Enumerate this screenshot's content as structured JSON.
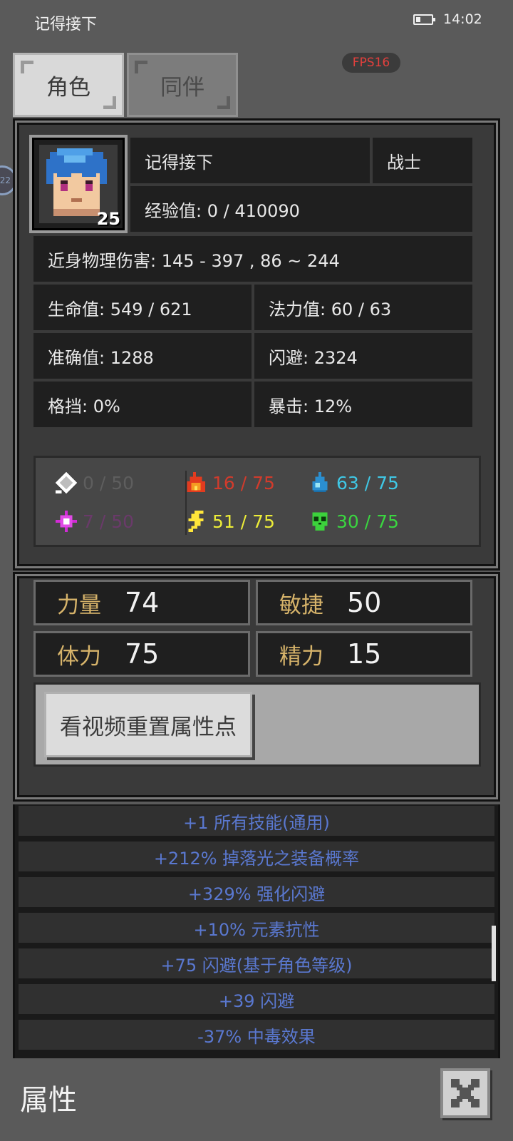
{
  "status_bar": {
    "app_title": "记得接下",
    "time": "14:02",
    "battery_icon": "battery-low-icon"
  },
  "tabs": [
    {
      "label": "角色",
      "active": true
    },
    {
      "label": "同伴",
      "active": false
    }
  ],
  "fps": "FPS16",
  "edge_badge": "22",
  "character": {
    "level": "25",
    "name": "记得接下",
    "class": "战士",
    "experience": "经验值: 0 / 410090",
    "melee_damage": "近身物理伤害: 145 - 397 , 86 ~ 244",
    "stats": {
      "hp": "生命值: 549 / 621",
      "mp": "法力值: 60 / 63",
      "accuracy": "准确值: 1288",
      "dodge": "闪避: 2324",
      "block": "格挡: 0%",
      "crit": "暴击: 12%"
    }
  },
  "resistances": [
    {
      "icon": "physical-shield-icon",
      "value": "0 / 50",
      "color": "#5e5e5e"
    },
    {
      "icon": "fire-icon",
      "value": "16 / 75",
      "color": "#d23b2c"
    },
    {
      "icon": "water-drop-icon",
      "value": "63 / 75",
      "color": "#3fc8e6"
    },
    {
      "icon": "magic-star-icon",
      "value": "7 / 50",
      "color": "#6a3a6a"
    },
    {
      "icon": "lightning-icon",
      "value": "51 / 75",
      "color": "#ecec38"
    },
    {
      "icon": "poison-skull-icon",
      "value": "30 / 75",
      "color": "#3ad640"
    }
  ],
  "attributes": [
    {
      "label": "力量",
      "value": "74"
    },
    {
      "label": "敏捷",
      "value": "50"
    },
    {
      "label": "体力",
      "value": "75"
    },
    {
      "label": "精力",
      "value": "15"
    }
  ],
  "reset_button": "看视频重置属性点",
  "bonuses": [
    "+1 所有技能(通用)",
    "+212% 掉落光之装备概率",
    "+329% 强化闪避",
    "+10% 元素抗性",
    "+75 闪避(基于角色等级)",
    "+39 闪避",
    "-37% 中毒效果"
  ],
  "footer": {
    "title": "属性",
    "close_icon": "close-x-icon"
  },
  "colors": {
    "background": "#5a5a5a",
    "panel": "#3a3a3a",
    "cell": "#1f1f1f",
    "attribute_label": "#d6b36a",
    "bonus_text": "#5a78d0",
    "fps_text": "#e3403d"
  }
}
